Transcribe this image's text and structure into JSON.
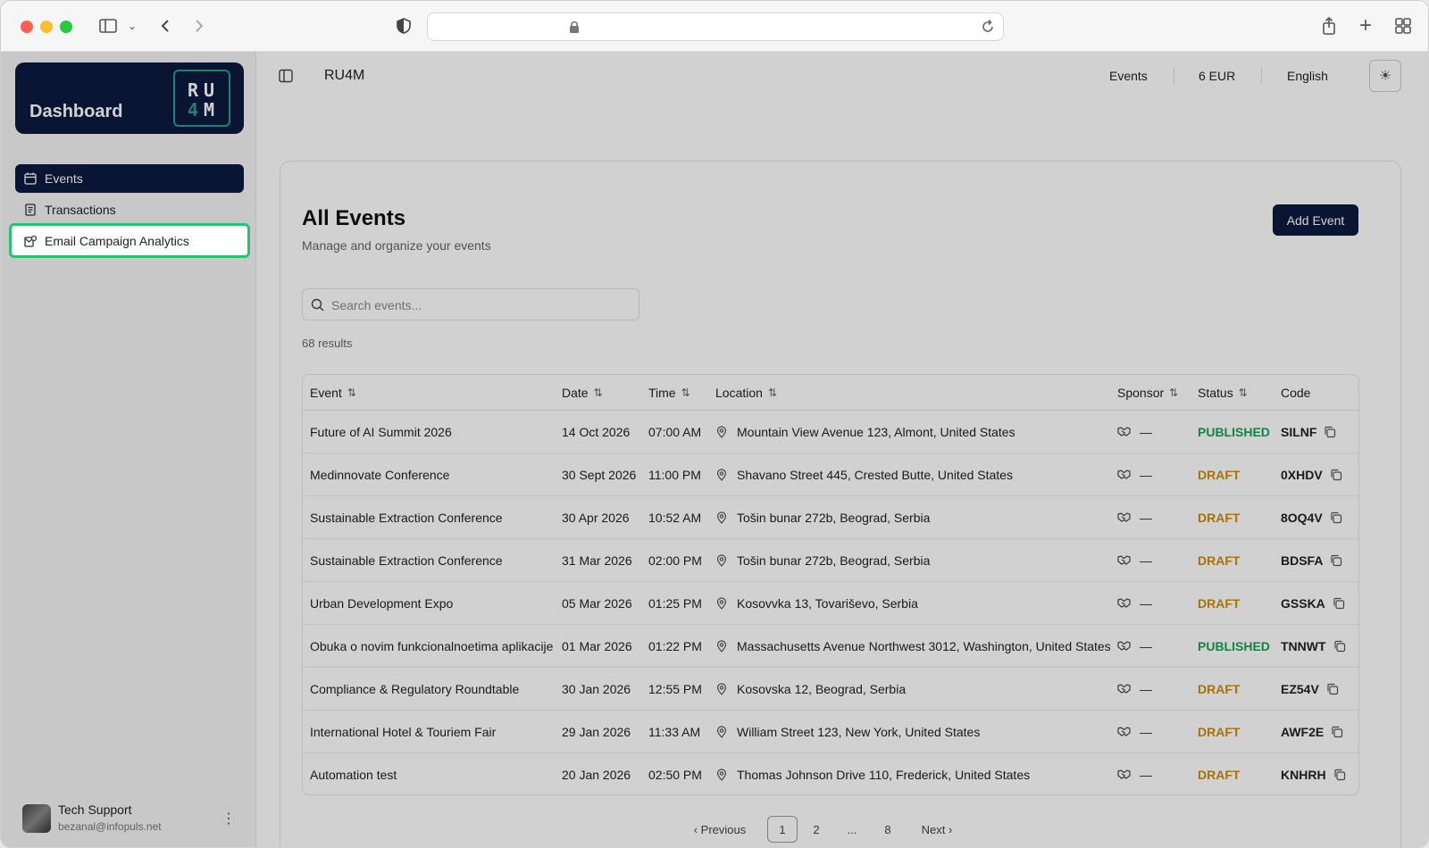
{
  "app": {
    "brand_title": "Dashboard",
    "logo_line1": "RU",
    "logo_line2a": "4",
    "logo_line2b": "M",
    "org_name": "RU4M",
    "topbar_links": {
      "events": "Events",
      "currency": "6 EUR",
      "language": "English"
    }
  },
  "sidebar": {
    "items": [
      {
        "label": "Events",
        "icon": "calendar-icon",
        "active": true
      },
      {
        "label": "Transactions",
        "icon": "receipt-icon",
        "active": false
      },
      {
        "label": "Email Campaign Analytics",
        "icon": "mail-chart-icon",
        "active": false,
        "highlighted": true
      }
    ],
    "user": {
      "name": "Tech Support",
      "email": "bezanal@infopuls.net"
    }
  },
  "main": {
    "title": "All Events",
    "subtitle": "Manage and organize your events",
    "add_button": "Add Event",
    "search_placeholder": "Search events...",
    "results_text": "68 results",
    "columns": [
      "Event",
      "Date",
      "Time",
      "Location",
      "Sponsor",
      "Status",
      "Code"
    ],
    "rows": [
      {
        "event": "Future of AI Summit 2026",
        "date": "14 Oct 2026",
        "time": "07:00 AM",
        "location": "Mountain View Avenue 123, Almont, United States",
        "sponsor": "—",
        "status": "PUBLISHED",
        "code": "SILNF"
      },
      {
        "event": "Medinnovate Conference",
        "date": "30 Sept 2026",
        "time": "11:00 PM",
        "location": "Shavano Street 445, Crested Butte, United States",
        "sponsor": "—",
        "status": "DRAFT",
        "code": "0XHDV"
      },
      {
        "event": "Sustainable Extraction Conference",
        "date": "30 Apr 2026",
        "time": "10:52 AM",
        "location": "Tošin bunar 272b, Beograd, Serbia",
        "sponsor": "—",
        "status": "DRAFT",
        "code": "8OQ4V"
      },
      {
        "event": "Sustainable Extraction Conference",
        "date": "31 Mar 2026",
        "time": "02:00 PM",
        "location": "Tošin bunar 272b, Beograd, Serbia",
        "sponsor": "—",
        "status": "DRAFT",
        "code": "BDSFA"
      },
      {
        "event": "Urban Development Expo",
        "date": "05 Mar 2026",
        "time": "01:25 PM",
        "location": "Kosovvka 13, Tovariševo, Serbia",
        "sponsor": "—",
        "status": "DRAFT",
        "code": "GSSKA"
      },
      {
        "event": "Obuka o novim funkcionalnoetima aplikacije",
        "date": "01 Mar 2026",
        "time": "01:22 PM",
        "location": "Massachusetts Avenue Northwest 3012, Washington, United States",
        "sponsor": "—",
        "status": "PUBLISHED",
        "code": "TNNWT"
      },
      {
        "event": "Compliance & Regulatory Roundtable",
        "date": "30 Jan 2026",
        "time": "12:55 PM",
        "location": "Kosovska 12, Beograd, Serbia",
        "sponsor": "—",
        "status": "DRAFT",
        "code": "EZ54V"
      },
      {
        "event": "International Hotel & Touriem Fair",
        "date": "29 Jan 2026",
        "time": "11:33 AM",
        "location": "William Street 123, New York, United States",
        "sponsor": "—",
        "status": "DRAFT",
        "code": "AWF2E"
      },
      {
        "event": "Automation test",
        "date": "20 Jan 2026",
        "time": "02:50 PM",
        "location": "Thomas Johnson Drive 110, Frederick, United States",
        "sponsor": "—",
        "status": "DRAFT",
        "code": "KNHRH"
      }
    ],
    "pagination": {
      "previous": "‹ Previous",
      "pages": [
        "1",
        "2",
        "...",
        "8"
      ],
      "current": "1",
      "next": "Next ›"
    }
  },
  "colors": {
    "brand_navy": "#0b1a3e",
    "published": "#1f9d55",
    "draft": "#c98a14",
    "highlight": "#27c46b"
  }
}
